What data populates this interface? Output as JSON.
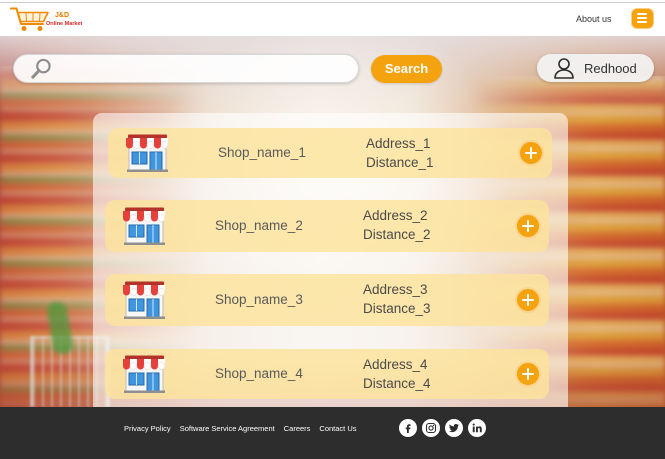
{
  "header": {
    "logo": {
      "icon": "shopping-cart-logo-icon",
      "brand": "J&D",
      "tagline": "Online Market"
    },
    "about_label": "About us",
    "menu_icon": "hamburger-menu-icon"
  },
  "search": {
    "icon": "search-icon",
    "value": "",
    "button_label": "Search"
  },
  "user": {
    "icon": "user-icon",
    "name": "Redhood"
  },
  "shops": [
    {
      "icon": "store-icon",
      "name": "Shop_name_1",
      "address": "Address_1",
      "distance": "Distance_1",
      "action_icon": "plus-icon"
    },
    {
      "icon": "store-icon",
      "name": "Shop_name_2",
      "address": "Address_2",
      "distance": "Distance_2",
      "action_icon": "plus-icon"
    },
    {
      "icon": "store-icon",
      "name": "Shop_name_3",
      "address": "Address_3",
      "distance": "Distance_3",
      "action_icon": "plus-icon"
    },
    {
      "icon": "store-icon",
      "name": "Shop_name_4",
      "address": "Address_4",
      "distance": "Distance_4",
      "action_icon": "plus-icon"
    }
  ],
  "footer": {
    "links": [
      "Privacy Policy",
      "Software Service Agreement",
      "Careers",
      "Contact Us"
    ],
    "social_icons": [
      "facebook-icon",
      "instagram-icon",
      "twitter-icon",
      "linkedin-icon"
    ]
  },
  "colors": {
    "accent": "#f5a20f",
    "header_background": "#ffffff",
    "card_background": "#fde39ad0",
    "footer_background": "#2d2d2d",
    "footer_text": "#ffffff",
    "logo_brand": "#e07b00",
    "logo_tagline": "#d42a2a"
  }
}
